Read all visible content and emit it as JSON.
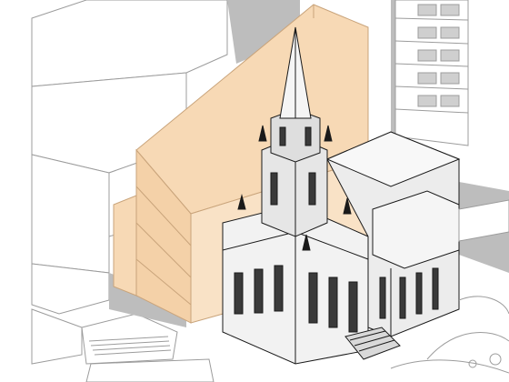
{
  "scene": {
    "kind": "architectural-axonometric-render",
    "colors": {
      "background": "#ffffff",
      "context_fill": "#ffffff",
      "context_stroke": "#9c9c9c",
      "shadow": "#bdbdbd",
      "highlight_fill": "#f7d9b5",
      "highlight_stroke": "#c9a47b",
      "building_stroke": "#1a1a1a",
      "building_fill": "#f2f2f2",
      "window_fill": "#3a3a3a"
    }
  }
}
